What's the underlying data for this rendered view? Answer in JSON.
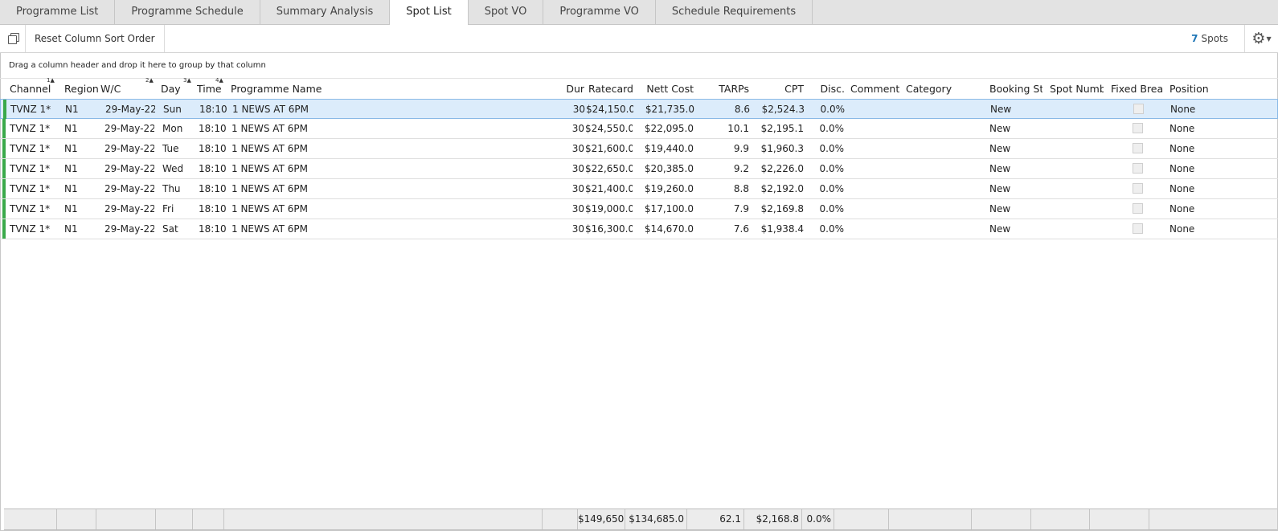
{
  "tabs": [
    {
      "label": "Programme List",
      "active": false
    },
    {
      "label": "Programme Schedule",
      "active": false
    },
    {
      "label": "Summary Analysis",
      "active": false
    },
    {
      "label": "Spot List",
      "active": true
    },
    {
      "label": "Spot VO",
      "active": false
    },
    {
      "label": "Programme VO",
      "active": false
    },
    {
      "label": "Schedule Requirements",
      "active": false
    }
  ],
  "toolbar": {
    "copy_icon": "copy-icon",
    "reset_label": "Reset Column Sort Order",
    "spot_count": "7",
    "spot_count_label": "Spots",
    "settings_icon": "gear-icon",
    "accent_color": "#1f76b6"
  },
  "group_panel_text": "Drag a column header and drop it here to group by that column",
  "grid": {
    "columns": {
      "channel": "Channel",
      "region": "Region",
      "wc": "W/C",
      "day": "Day",
      "time": "Time",
      "programme": "Programme Name",
      "dur": "Dur",
      "ratecard": "Ratecard",
      "nett": "Nett Cost",
      "tarps": "TARPs",
      "cpt": "CPT",
      "disc": "Disc.",
      "comment": "Comment",
      "category": "Category",
      "booking": "Booking Stat",
      "spotnum": "Spot Numbe",
      "fixed": "Fixed Break",
      "position": "Position"
    },
    "sort_order": {
      "channel": "1",
      "wc": "2",
      "day": "3",
      "time": "4"
    },
    "row_marker_color": "#3aa94a",
    "rows": [
      {
        "channel": "TVNZ 1*",
        "region": "N1",
        "wc": "29-May-22",
        "day": "Sun",
        "time": "18:10",
        "programme": "1 NEWS AT 6PM",
        "dur": "30",
        "ratecard": "$24,150.0",
        "nett": "$21,735.0",
        "tarps": "8.6",
        "cpt": "$2,524.3",
        "disc": "0.0%",
        "comment": "",
        "category": "",
        "booking": "New",
        "spotnum": "",
        "fixed": false,
        "position": "None",
        "selected": true
      },
      {
        "channel": "TVNZ 1*",
        "region": "N1",
        "wc": "29-May-22",
        "day": "Mon",
        "time": "18:10",
        "programme": "1 NEWS AT 6PM",
        "dur": "30",
        "ratecard": "$24,550.0",
        "nett": "$22,095.0",
        "tarps": "10.1",
        "cpt": "$2,195.1",
        "disc": "0.0%",
        "comment": "",
        "category": "",
        "booking": "New",
        "spotnum": "",
        "fixed": false,
        "position": "None",
        "selected": false
      },
      {
        "channel": "TVNZ 1*",
        "region": "N1",
        "wc": "29-May-22",
        "day": "Tue",
        "time": "18:10",
        "programme": "1 NEWS AT 6PM",
        "dur": "30",
        "ratecard": "$21,600.0",
        "nett": "$19,440.0",
        "tarps": "9.9",
        "cpt": "$1,960.3",
        "disc": "0.0%",
        "comment": "",
        "category": "",
        "booking": "New",
        "spotnum": "",
        "fixed": false,
        "position": "None",
        "selected": false
      },
      {
        "channel": "TVNZ 1*",
        "region": "N1",
        "wc": "29-May-22",
        "day": "Wed",
        "time": "18:10",
        "programme": "1 NEWS AT 6PM",
        "dur": "30",
        "ratecard": "$22,650.0",
        "nett": "$20,385.0",
        "tarps": "9.2",
        "cpt": "$2,226.0",
        "disc": "0.0%",
        "comment": "",
        "category": "",
        "booking": "New",
        "spotnum": "",
        "fixed": false,
        "position": "None",
        "selected": false
      },
      {
        "channel": "TVNZ 1*",
        "region": "N1",
        "wc": "29-May-22",
        "day": "Thu",
        "time": "18:10",
        "programme": "1 NEWS AT 6PM",
        "dur": "30",
        "ratecard": "$21,400.0",
        "nett": "$19,260.0",
        "tarps": "8.8",
        "cpt": "$2,192.0",
        "disc": "0.0%",
        "comment": "",
        "category": "",
        "booking": "New",
        "spotnum": "",
        "fixed": false,
        "position": "None",
        "selected": false
      },
      {
        "channel": "TVNZ 1*",
        "region": "N1",
        "wc": "29-May-22",
        "day": "Fri",
        "time": "18:10",
        "programme": "1 NEWS AT 6PM",
        "dur": "30",
        "ratecard": "$19,000.0",
        "nett": "$17,100.0",
        "tarps": "7.9",
        "cpt": "$2,169.8",
        "disc": "0.0%",
        "comment": "",
        "category": "",
        "booking": "New",
        "spotnum": "",
        "fixed": false,
        "position": "None",
        "selected": false
      },
      {
        "channel": "TVNZ 1*",
        "region": "N1",
        "wc": "29-May-22",
        "day": "Sat",
        "time": "18:10",
        "programme": "1 NEWS AT 6PM",
        "dur": "30",
        "ratecard": "$16,300.0",
        "nett": "$14,670.0",
        "tarps": "7.6",
        "cpt": "$1,938.4",
        "disc": "0.0%",
        "comment": "",
        "category": "",
        "booking": "New",
        "spotnum": "",
        "fixed": false,
        "position": "None",
        "selected": false
      }
    ],
    "totals": {
      "ratecard": "$149,650.0",
      "nett": "$134,685.0",
      "tarps": "62.1",
      "cpt": "$2,168.8",
      "disc": "0.0%"
    }
  }
}
